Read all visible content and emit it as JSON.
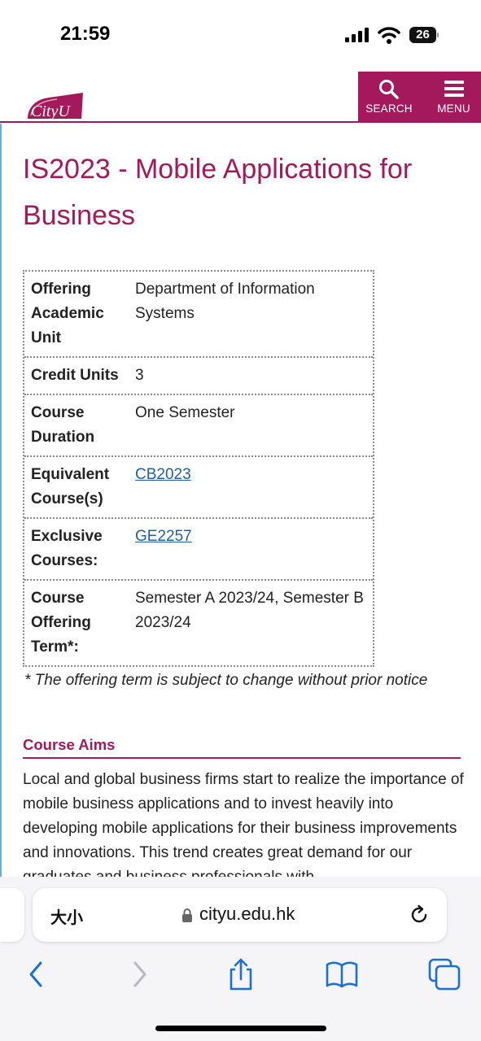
{
  "status_bar": {
    "time": "21:59",
    "battery_level": "26",
    "icons": [
      "signal-icon",
      "wifi-icon",
      "battery-icon"
    ]
  },
  "header": {
    "logo_text": "CityU",
    "search_label": "SEARCH",
    "menu_label": "MENU",
    "brand_color": "#a3195b"
  },
  "page": {
    "title": "IS2023 - Mobile Applications for Business"
  },
  "course_info": {
    "rows": [
      {
        "label": "Offering Academic Unit",
        "value": "Department of Information Systems"
      },
      {
        "label": "Credit Units",
        "value": "3"
      },
      {
        "label": "Course Duration",
        "value": "One Semester"
      },
      {
        "label": "Equivalent Course(s)",
        "value": "CB2023"
      },
      {
        "label": "Exclusive Courses:",
        "value": "GE2257"
      },
      {
        "label": "Course Offering Term*:",
        "value": "Semester A 2023/24, Semester B 2023/24"
      }
    ],
    "notice": "* The offering term is subject to change without prior notice"
  },
  "aims": {
    "heading": "Course Aims",
    "text": "Local and global business firms start to realize the importance of mobile business applications and to invest heavily into developing mobile applications for their business improvements and innovations.  This trend creates great demand for our graduates and business professionals with"
  },
  "browser": {
    "text_size_label": "大小",
    "url": "cityu.edu.hk",
    "toolbar_icons": [
      "back-icon",
      "forward-icon",
      "share-icon",
      "bookmarks-icon",
      "tabs-icon"
    ]
  }
}
